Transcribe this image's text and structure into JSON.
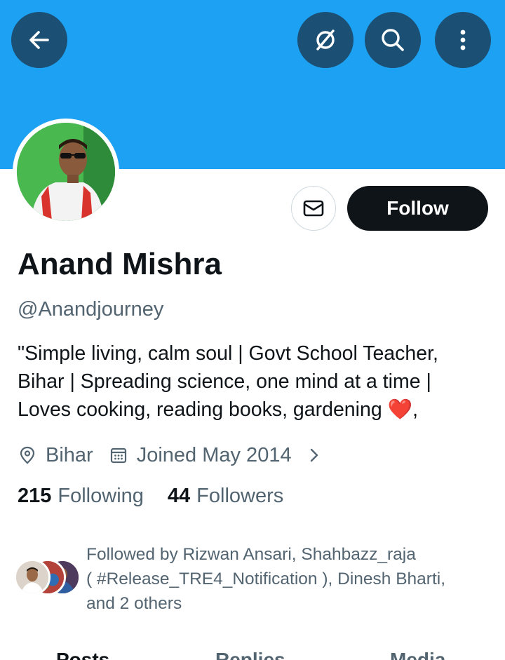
{
  "header": {
    "back_icon": "arrow-left-icon",
    "translate_icon": "grok-slash-icon",
    "search_icon": "search-icon",
    "more_icon": "more-vertical-icon",
    "banner_color": "#1da1f2"
  },
  "profile": {
    "name": "Anand Mishra",
    "handle": "@Anandjourney",
    "bio_lines": [
      "\"Simple living, calm soul | Govt School Teacher,",
      "Bihar | Spreading science, one mind at a time |",
      "Loves cooking, reading books, gardening"
    ],
    "bio_tail": ",",
    "bio_emoji": "❤️",
    "location": "Bihar",
    "joined": "Joined May 2014",
    "following_count": "215",
    "following_label": "Following",
    "followers_count": "44",
    "followers_label": "Followers"
  },
  "actions": {
    "message_icon": "envelope-icon",
    "follow_label": "Follow"
  },
  "followed_by": {
    "lines": [
      "Followed by Rizwan Ansari, Shahbazz_raja",
      "( #Release_TRE4_Notification ), Dinesh Bharti,",
      "and 2 others"
    ]
  },
  "tabs": {
    "posts": "Posts",
    "replies": "Replies",
    "media": "Media"
  }
}
